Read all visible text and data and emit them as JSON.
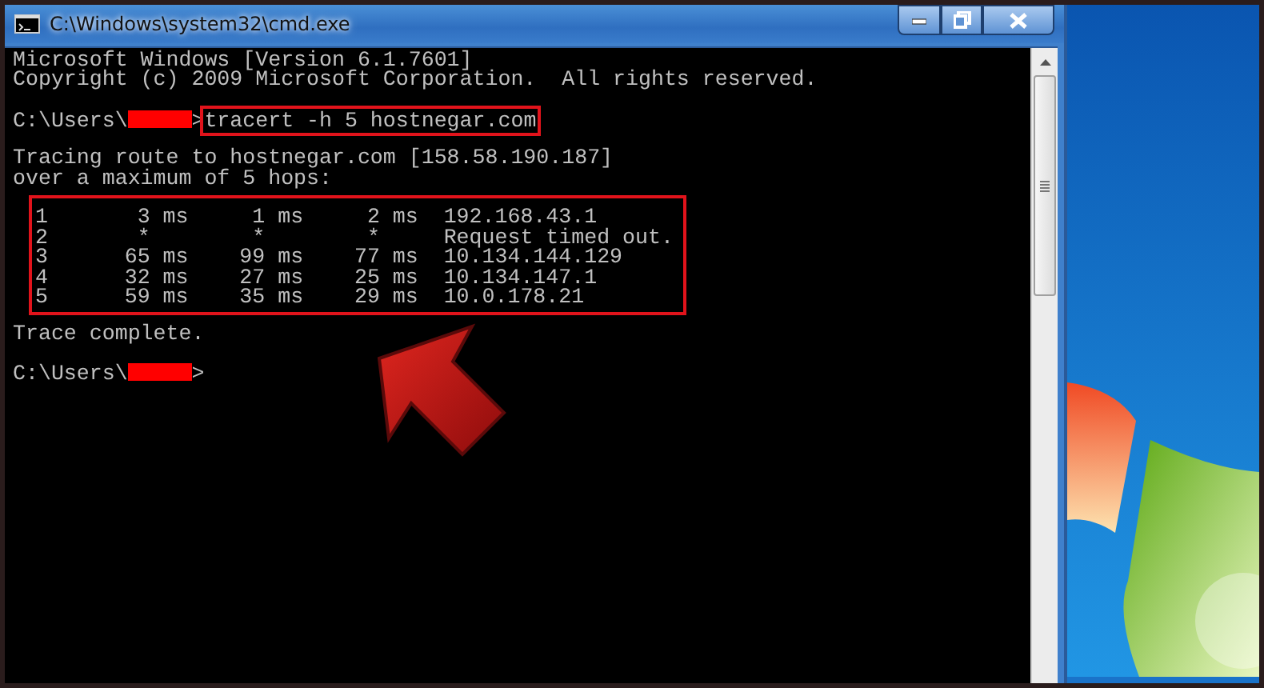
{
  "window": {
    "title": "C:\\Windows\\system32\\cmd.exe"
  },
  "console": {
    "lines": [
      {
        "kind": "text",
        "text": "Microsoft Windows [Version 6.1.7601]"
      },
      {
        "kind": "text",
        "text": "Copyright (c) 2009 Microsoft Corporation.  All rights reserved."
      },
      {
        "kind": "blank"
      },
      {
        "kind": "prompt",
        "path": "C:\\Users\\",
        "redacted": true,
        "symbol": ">",
        "command": "tracert -h 5 hostnegar.com",
        "highlighted": true
      },
      {
        "kind": "blank"
      },
      {
        "kind": "text",
        "text": "Tracing route to hostnegar.com [158.58.190.187]"
      },
      {
        "kind": "text",
        "text": "over a maximum of 5 hops:"
      },
      {
        "kind": "hops",
        "highlighted": true,
        "rows": [
          {
            "hop": "1",
            "times": [
              {
                "value": "3",
                "unit": "ms"
              },
              {
                "value": "1",
                "unit": "ms"
              },
              {
                "value": "2",
                "unit": "ms"
              }
            ],
            "host": "192.168.43.1"
          },
          {
            "hop": "2",
            "times": [
              {
                "value": "*"
              },
              {
                "value": "*"
              },
              {
                "value": "*"
              }
            ],
            "host": "Request timed out."
          },
          {
            "hop": "3",
            "times": [
              {
                "value": "65",
                "unit": "ms"
              },
              {
                "value": "99",
                "unit": "ms"
              },
              {
                "value": "77",
                "unit": "ms"
              }
            ],
            "host": "10.134.144.129"
          },
          {
            "hop": "4",
            "times": [
              {
                "value": "32",
                "unit": "ms"
              },
              {
                "value": "27",
                "unit": "ms"
              },
              {
                "value": "25",
                "unit": "ms"
              }
            ],
            "host": "10.134.147.1"
          },
          {
            "hop": "5",
            "times": [
              {
                "value": "59",
                "unit": "ms"
              },
              {
                "value": "35",
                "unit": "ms"
              },
              {
                "value": "29",
                "unit": "ms"
              }
            ],
            "host": "10.0.178.21"
          }
        ]
      },
      {
        "kind": "text",
        "text": "Trace complete."
      },
      {
        "kind": "blank"
      },
      {
        "kind": "prompt",
        "path": "C:\\Users\\",
        "redacted": true,
        "symbol": ">"
      }
    ]
  }
}
